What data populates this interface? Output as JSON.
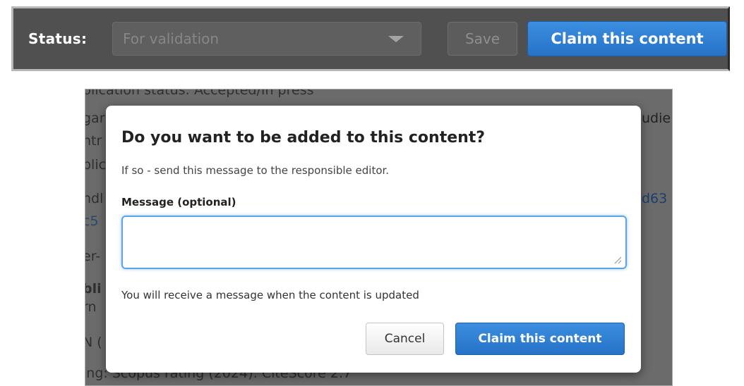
{
  "toolbar": {
    "status_label": "Status:",
    "status_select_value": "For validation",
    "save_label": "Save",
    "claim_label": "Claim this content"
  },
  "background_fragments": {
    "line1": "plication status: Accepted/In press",
    "line2": "gar",
    "line3": "ntr",
    "line4": "blic",
    "line5": "ndl",
    "line6": "c5",
    "line7": "er-",
    "line8": "bli",
    "line9": "rn",
    "line10": "N (",
    "line11": "ing: Scopus rating (2024): CiteScore 2.7",
    "right1": "udie",
    "right2": "d63"
  },
  "modal": {
    "title": "Do you want to be added to this content?",
    "subtitle": "If so - send this message to the responsible editor.",
    "message_label": "Message (optional)",
    "message_value": "",
    "hint": "You will receive a message when the content is updated",
    "cancel_label": "Cancel",
    "claim_label": "Claim this content"
  },
  "colors": {
    "primary_button": "#2a78cc",
    "toolbar_bg": "#505050",
    "focus_ring": "#5aa5ea"
  }
}
